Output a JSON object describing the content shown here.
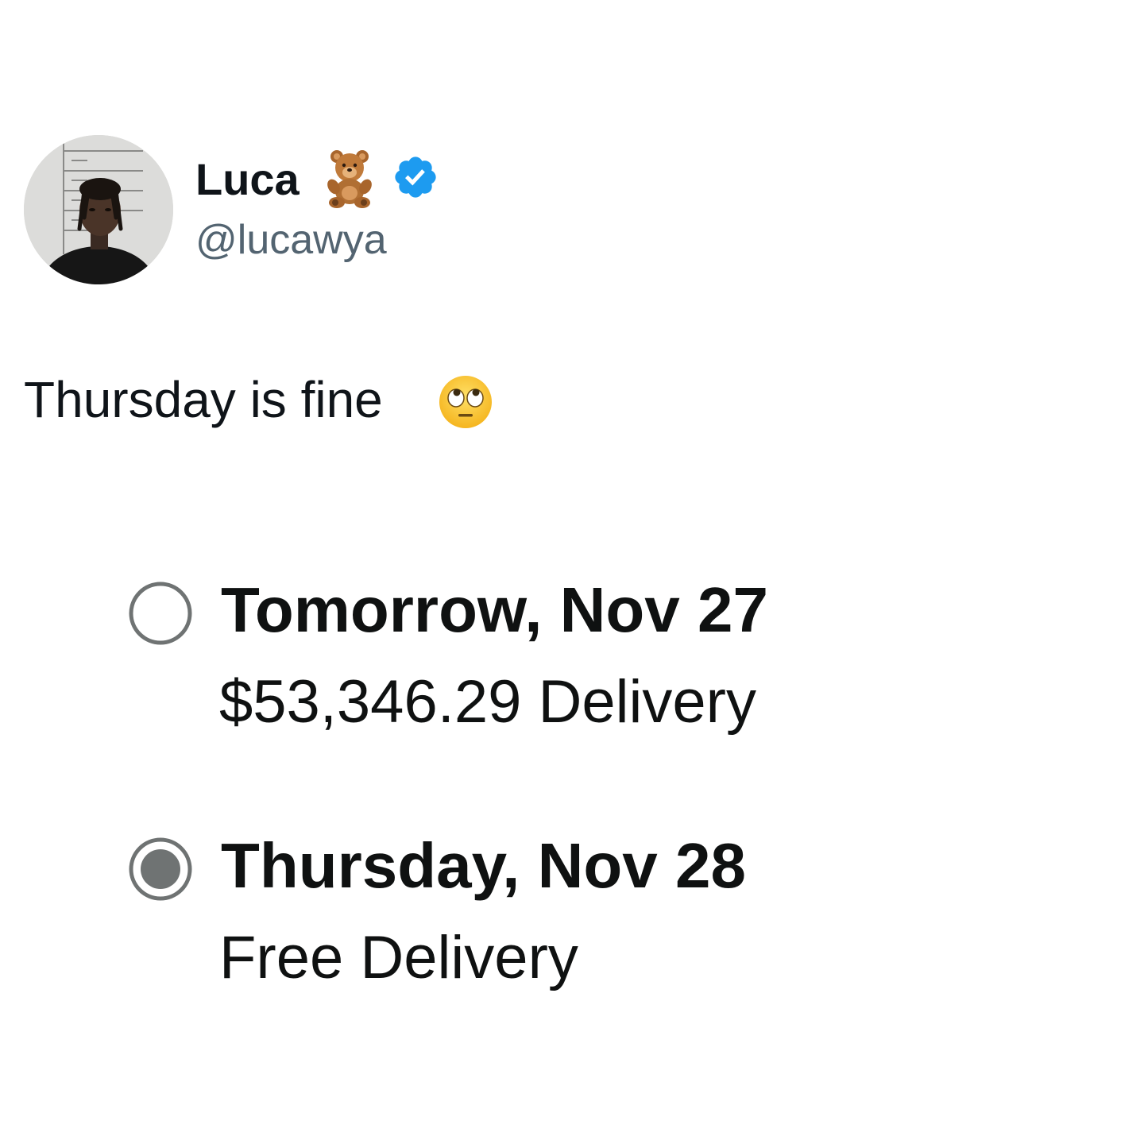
{
  "tweet": {
    "author": {
      "display_name": "Luca",
      "name_emoji_icon": "teddy-bear-icon",
      "verified_icon": "verified-badge-icon",
      "handle": "@lucawya"
    },
    "text": "Thursday is fine",
    "text_emoji_icon": "face-with-rolling-eyes-icon"
  },
  "delivery_options": [
    {
      "title": "Tomorrow, Nov 27",
      "subtitle": "$53,346.29 Delivery",
      "selected": false
    },
    {
      "title": "Thursday, Nov 28",
      "subtitle": "Free Delivery",
      "selected": true
    }
  ],
  "colors": {
    "verified_blue": "#1d9bf0",
    "handle_gray": "#536471",
    "radio_gray": "#6f7373",
    "text_black": "#0f1111"
  }
}
